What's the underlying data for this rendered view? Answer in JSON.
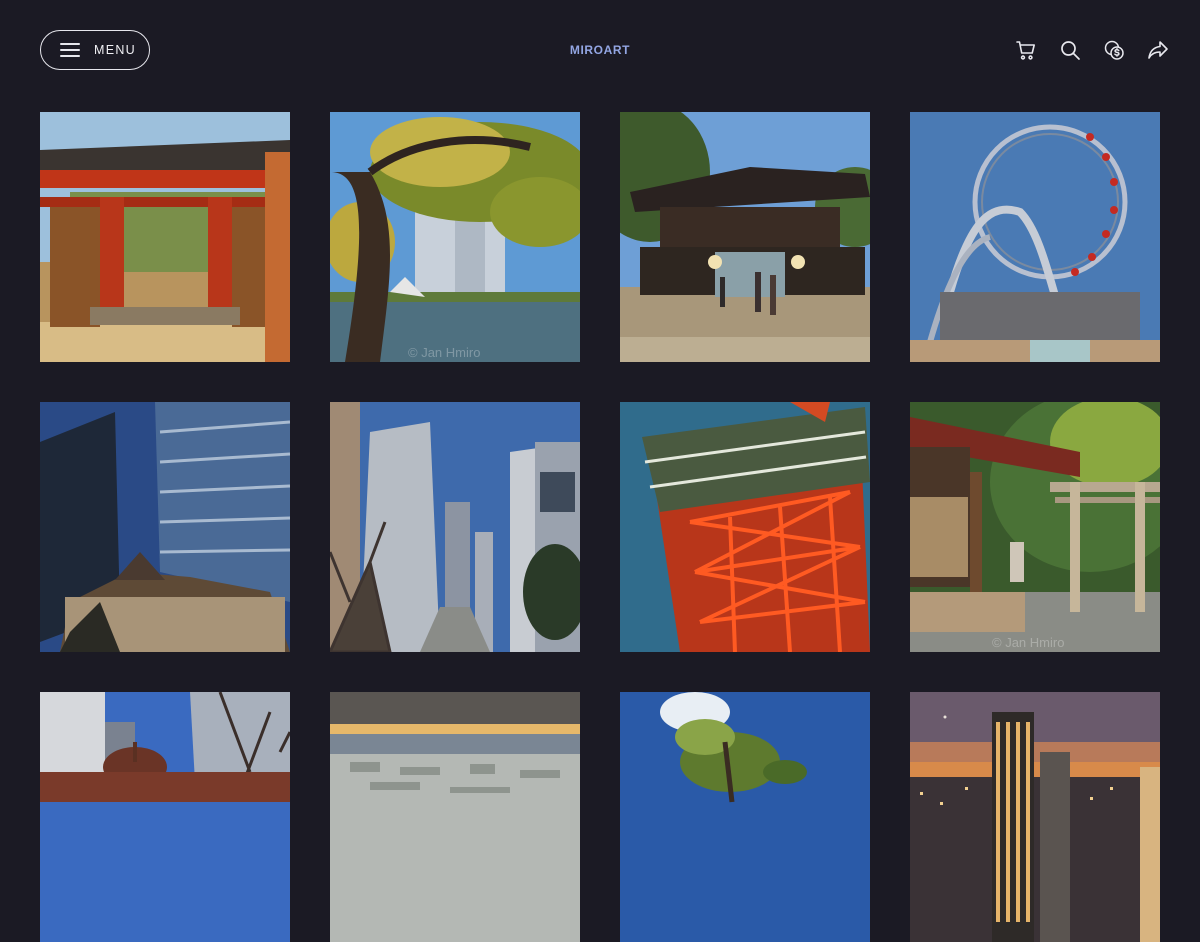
{
  "header": {
    "menu_label": "MENU",
    "brand": "MIROART",
    "icons": [
      "cart-icon",
      "search-icon",
      "currency-icon",
      "share-icon"
    ]
  },
  "colors": {
    "background": "#1b1a24",
    "brand": "#93a6e3",
    "menu_border": "#e6e6ec"
  },
  "gallery": {
    "watermark": "© Jan Hmiro",
    "photos": [
      "temple-gate-photo",
      "pine-tree-pond-photo",
      "shrine-gate-photo",
      "ferris-wheel-coaster-photo",
      "glass-tower-building-photo",
      "skyscrapers-street-photo",
      "tokyo-tower-photo",
      "shrine-torii-photo",
      "station-building-photo",
      "city-panorama-photo",
      "pine-tree-sky-photo",
      "night-tower-photo"
    ]
  }
}
